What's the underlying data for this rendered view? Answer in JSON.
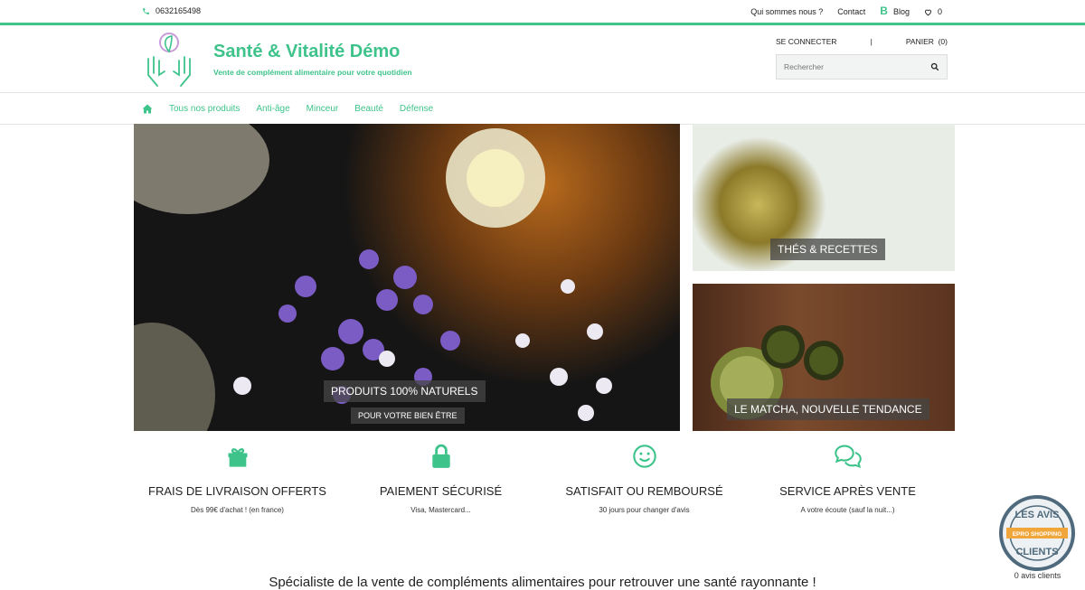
{
  "topbar": {
    "phone": "0632165498",
    "links": [
      "Qui sommes nous ?",
      "Contact"
    ],
    "blog": "Blog",
    "wishlist_count": "0"
  },
  "brand": {
    "title": "Santé & Vitalité Démo",
    "subtitle": "Vente de complément alimentaire pour votre quotidien"
  },
  "account": {
    "login": "SE CONNECTER",
    "separator": "|",
    "cart": "PANIER  (0)"
  },
  "search": {
    "placeholder": "Rechercher"
  },
  "nav": [
    "Tous nos produits",
    "Anti-âge",
    "Minceur",
    "Beauté",
    "Défense"
  ],
  "banners": {
    "main_title": "PRODUITS 100% NATURELS",
    "main_sub": "POUR VOTRE BIEN ÊTRE",
    "side1": "THÉS & RECETTES",
    "side2": "LE MATCHA, NOUVELLE TENDANCE"
  },
  "features": [
    {
      "icon": "gift-icon",
      "title": "FRAIS DE LIVRAISON OFFERTS",
      "sub": "Dès 99€ d'achat ! (en france)"
    },
    {
      "icon": "lock-icon",
      "title": "PAIEMENT SÉCURISÉ",
      "sub": "Visa, Mastercard..."
    },
    {
      "icon": "smile-icon",
      "title": "SATISFAIT OU REMBOURSÉ",
      "sub": "30 jours pour changer d'avis"
    },
    {
      "icon": "chat-icon",
      "title": "SERVICE APRÈS VENTE",
      "sub": "A votre écoute (sauf la nuit...)"
    }
  ],
  "tagline": "Spécialiste de la vente de compléments alimentaires pour retrouver une santé rayonnante !",
  "reviews": {
    "badge_top": "LES AVIS",
    "badge_mid": "EPRO SHOPPING",
    "badge_bottom": "CLIENTS",
    "count": "0 avis clients"
  },
  "colors": {
    "accent": "#3ec38b"
  }
}
